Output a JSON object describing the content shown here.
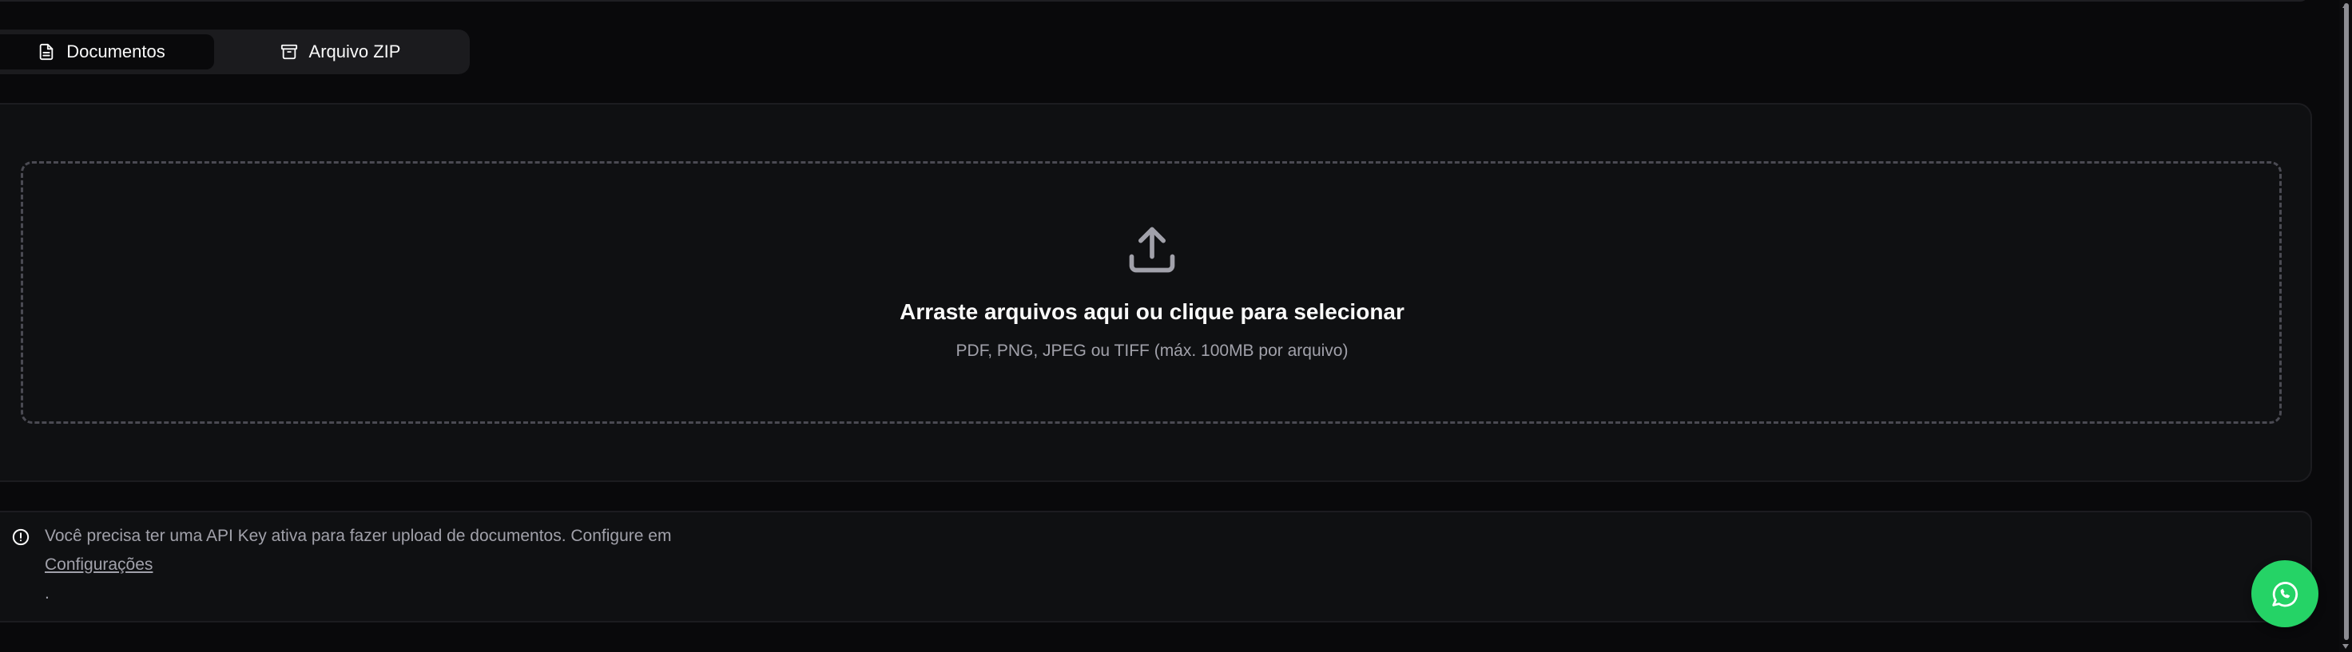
{
  "tabs": {
    "documents_label": "Documentos",
    "zip_label": "Arquivo ZIP",
    "active": "Documentos"
  },
  "upload": {
    "title": "Arraste arquivos aqui ou clique para selecionar",
    "subtitle": "PDF, PNG, JPEG ou TIFF (máx. 100MB por arquivo)",
    "icon": "upload-icon"
  },
  "alert": {
    "icon": "info-circle-icon",
    "message": "Você precisa ter uma API Key ativa para fazer upload de documentos. Configure em",
    "link_label": "Configurações",
    "trailing": "."
  },
  "whatsapp": {
    "icon": "whatsapp-icon",
    "color": "#25d366"
  },
  "theme": {
    "background": "#09090b",
    "card": "#0f1012",
    "muted_text": "#a1a1aa"
  }
}
